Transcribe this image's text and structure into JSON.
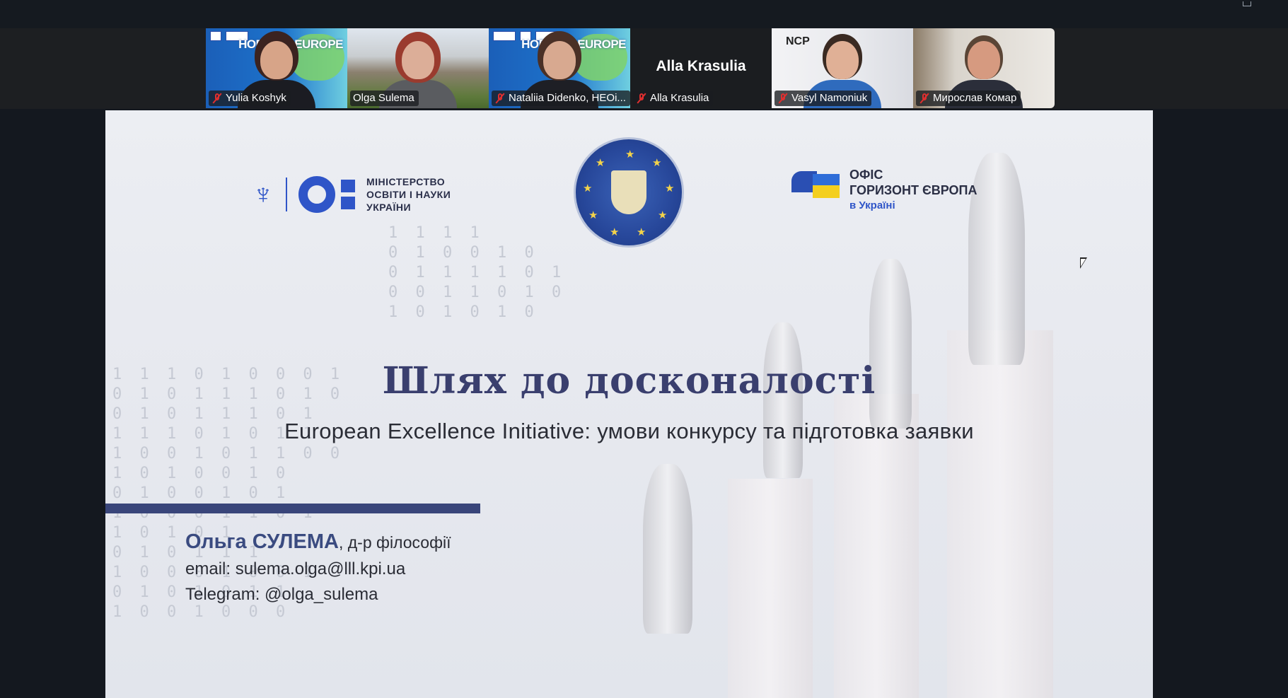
{
  "participants": [
    {
      "name": "Yulia Koshyk",
      "muted": true,
      "background": "horizon-europe"
    },
    {
      "name": "Olga Sulema",
      "muted": false,
      "background": "building"
    },
    {
      "name": "Nataliia Didenko, HEOi...",
      "muted": true,
      "background": "horizon-europe",
      "active_speaker": true
    },
    {
      "name": "Alla Krasulia",
      "display_name": "Alla Krasulia",
      "muted": true,
      "video_off": true
    },
    {
      "name": "Vasyl Namoniuk",
      "muted": true,
      "background": "ncp"
    },
    {
      "name": "Мирослав Комар",
      "muted": true,
      "background": "office"
    }
  ],
  "tile_badges": {
    "horizon_text": "HORIZON EUROPE",
    "ncp_text": "NCP"
  },
  "slide": {
    "ministry_text": "МІНІСТЕРСТВО\nОСВІТИ І НАУКИ\nУКРАЇНИ",
    "office_line1": "ОФІС",
    "office_line2": "ГОРИЗОНТ ЄВРОПА",
    "office_line3": "в Україні",
    "title": "Шлях до досконалості",
    "subtitle": "European Excellence Initiative: умови конкурсу та підготовка заявки",
    "author_name": "Ольга СУЛЕМА",
    "author_degree": ", д-р філософії",
    "email": "email: sulema.olga@lll.kpi.ua",
    "telegram": "Telegram: @olga_sulema"
  },
  "colors": {
    "active_speaker_border": "#23d160",
    "muted_icon": "#e02f2f",
    "slide_title": "#3a3f6e",
    "accent_blue": "#2f55c8",
    "rule": "#39457a"
  }
}
